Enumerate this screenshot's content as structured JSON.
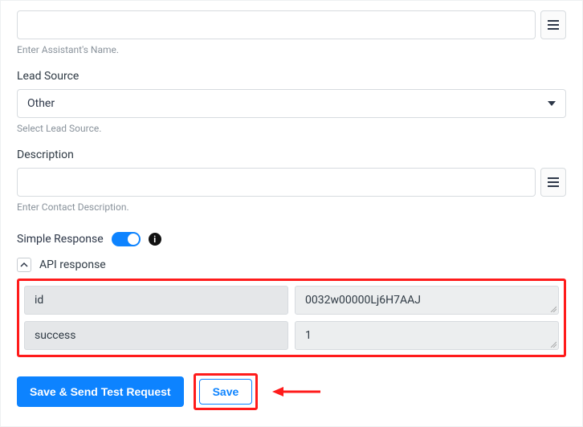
{
  "assistant": {
    "value": "",
    "helper": "Enter Assistant's Name."
  },
  "leadSource": {
    "label": "Lead Source",
    "value": "Other",
    "helper": "Select Lead Source."
  },
  "description": {
    "label": "Description",
    "value": "",
    "helper": "Enter Contact Description."
  },
  "simpleResponse": {
    "label": "Simple Response",
    "enabled": true
  },
  "apiResponse": {
    "title": "API response",
    "rows": [
      {
        "key": "id",
        "value": "0032w00000Lj6H7AAJ"
      },
      {
        "key": "success",
        "value": "1"
      }
    ]
  },
  "buttons": {
    "saveSend": "Save & Send Test Request",
    "save": "Save"
  }
}
